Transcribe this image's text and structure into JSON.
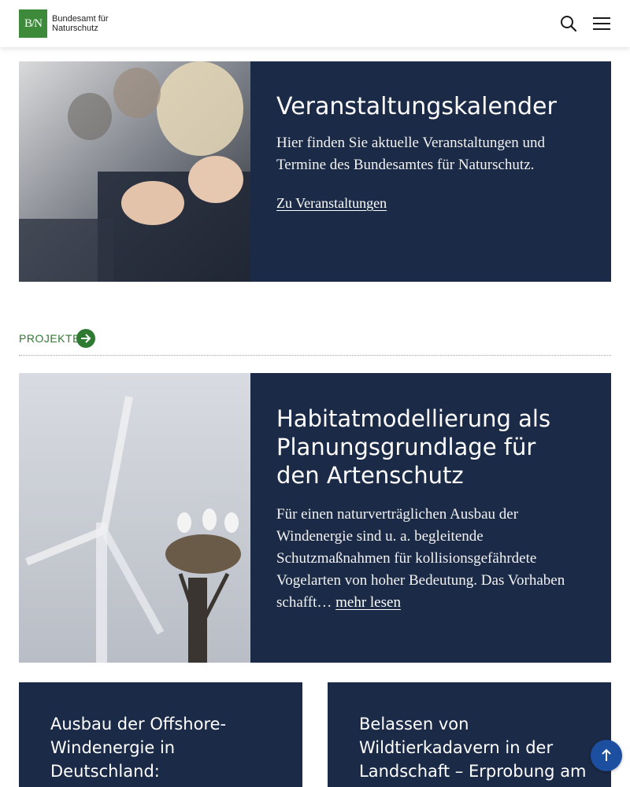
{
  "header": {
    "logo_mark": "B/N",
    "logo_line1": "Bundesamt für",
    "logo_line2": "Naturschutz",
    "search_icon": "search-icon",
    "menu_icon": "hamburger-menu-icon"
  },
  "event_card": {
    "title": "Veranstaltungskalender",
    "text": "Hier finden Sie aktuelle Veranstaltungen und Termine des Bundesamtes für Naturschutz.",
    "link": "Zu Veranstaltungen"
  },
  "projects_section": {
    "label": "PROJEKTE",
    "arrow_icon": "arrow-right-icon"
  },
  "project_card": {
    "title": "Habitatmodellierung als Planungsgrundlage für den Artenschutz",
    "text": "Für einen naturverträglichen Ausbau der Windenergie sind u. a. begleitende Schutzmaßnahmen für kollisionsgefährdete Vogelarten von hoher Bedeutung. Das Vorhaben schafft…",
    "more_link": "mehr lesen"
  },
  "small_cards": [
    {
      "title": "Ausbau der Offshore-Windenergie in Deutschland: Auswirkungen"
    },
    {
      "title": "Belassen von Wildtierkadavern in der Landschaft – Erprobung am"
    }
  ],
  "scroll_top_icon": "arrow-up-icon",
  "colors": {
    "card_bg": "#1b2a47",
    "brand_green": "#3c8a3a",
    "scroll_button": "#1d4fa0"
  }
}
